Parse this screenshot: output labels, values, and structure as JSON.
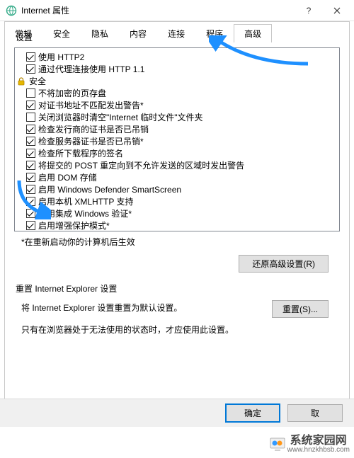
{
  "window": {
    "title": "Internet 属性",
    "help_glyph": "?",
    "close_glyph": "✕"
  },
  "tabs": {
    "items": [
      {
        "label": "常规"
      },
      {
        "label": "安全"
      },
      {
        "label": "隐私"
      },
      {
        "label": "内容"
      },
      {
        "label": "连接"
      },
      {
        "label": "程序"
      },
      {
        "label": "高级"
      }
    ],
    "active_index": 6
  },
  "settings_group_label": "设置",
  "tree": [
    {
      "type": "item",
      "checked": true,
      "label": "使用 HTTP2"
    },
    {
      "type": "item",
      "checked": true,
      "label": "通过代理连接使用 HTTP 1.1"
    },
    {
      "type": "category",
      "icon": "lock",
      "label": "安全"
    },
    {
      "type": "item",
      "checked": false,
      "label": "不将加密的页存盘"
    },
    {
      "type": "item",
      "checked": true,
      "label": "对证书地址不匹配发出警告*"
    },
    {
      "type": "item",
      "checked": false,
      "label": "关闭浏览器时清空\"Internet 临时文件\"文件夹"
    },
    {
      "type": "item",
      "checked": true,
      "label": "检查发行商的证书是否已吊销"
    },
    {
      "type": "item",
      "checked": true,
      "label": "检查服务器证书是否已吊销*"
    },
    {
      "type": "item",
      "checked": true,
      "label": "检查所下载程序的签名"
    },
    {
      "type": "item",
      "checked": true,
      "label": "将提交的 POST 重定向到不允许发送的区域时发出警告"
    },
    {
      "type": "item",
      "checked": true,
      "label": "启用 DOM 存储"
    },
    {
      "type": "item",
      "checked": true,
      "label": "启用 Windows Defender SmartScreen"
    },
    {
      "type": "item",
      "checked": true,
      "label": "启用本机 XMLHTTP 支持"
    },
    {
      "type": "item",
      "checked": true,
      "label": "启用集成 Windows 验证*"
    },
    {
      "type": "item",
      "checked": true,
      "label": "启用增强保护模式*"
    }
  ],
  "restart_note": "*在重新启动你的计算机后生效",
  "restore_button": "还原高级设置(R)",
  "reset_group_label": "重置 Internet Explorer 设置",
  "reset_text": "将 Internet Explorer 设置重置为默认设置。",
  "reset_button": "重置(S)...",
  "reset_note": "只有在浏览器处于无法使用的状态时，才应使用此设置。",
  "footer": {
    "ok": "确定",
    "cancel": "取"
  },
  "watermark": {
    "name": "系统家园网",
    "url": "www.hnzkhbsb.com"
  },
  "annotation": {
    "arrow_color": "#1e90ff"
  }
}
